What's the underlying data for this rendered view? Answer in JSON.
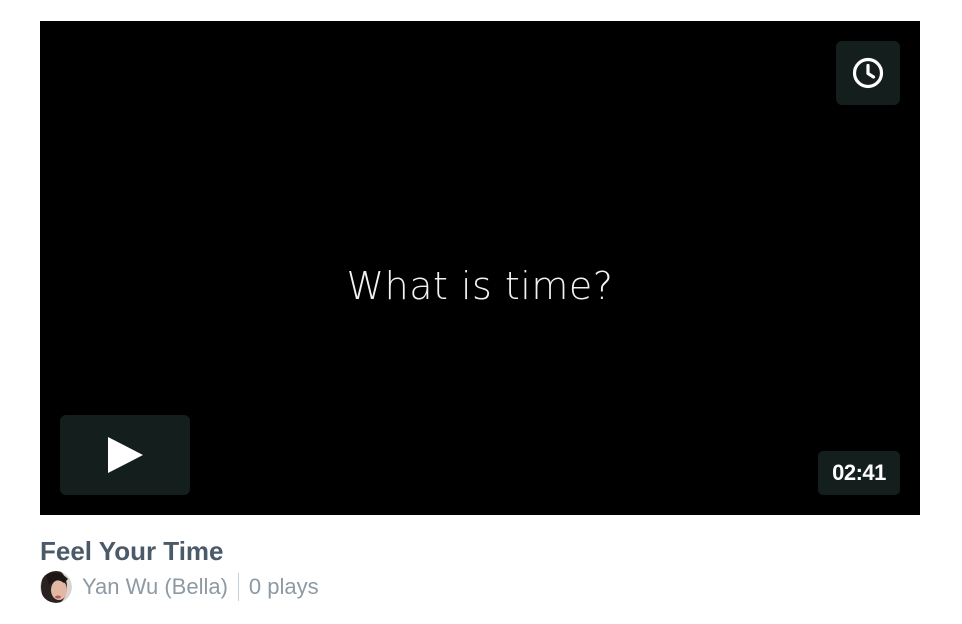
{
  "video": {
    "frame_text": "What is time?",
    "duration": "02:41",
    "title": "Feel Your Time"
  },
  "owner": {
    "name": "Yan Wu (Bella)",
    "plays": "0 plays"
  },
  "icons": {
    "watch_later": "clock-icon",
    "play": "play-icon"
  },
  "colors": {
    "player_bg": "#000000",
    "control_bg": "#172322",
    "title": "#4a5a68",
    "meta": "#8e9aa3"
  }
}
